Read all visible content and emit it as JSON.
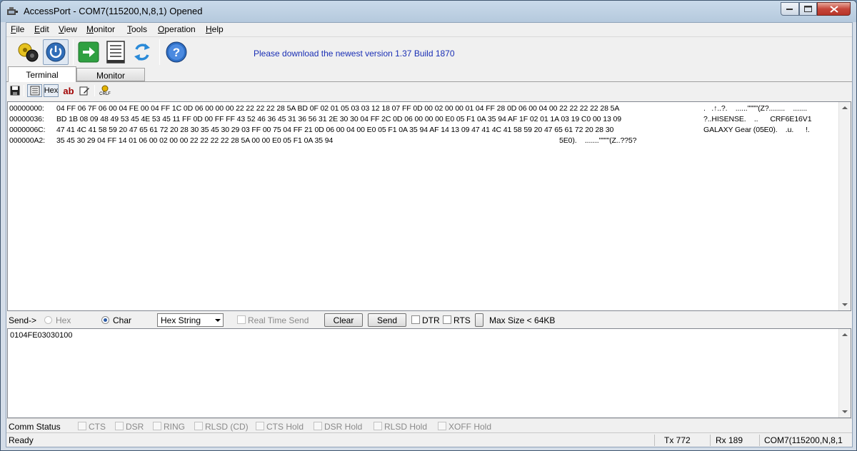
{
  "window": {
    "title": "AccessPort - COM7(115200,N,8,1) Opened"
  },
  "menu": [
    "File",
    "Edit",
    "View",
    "Monitor",
    "Tools",
    "Operation",
    "Help"
  ],
  "toolbar": {
    "promo": "Please download the newest version 1.37 Build 1870",
    "icons": [
      "settings-gear-icon",
      "power-icon",
      "arrow-right-icon",
      "document-icon",
      "refresh-icon",
      "help-icon"
    ]
  },
  "tabs": {
    "terminal": "Terminal",
    "monitor": "Monitor"
  },
  "subtoolbar": {
    "hex": "Hex",
    "ab": "ab",
    "crlf": "CRLF"
  },
  "terminal": {
    "lines": [
      {
        "addr": "00000000:",
        "hex": "04 FF 06 7F 06 00 04 FE 00 04 FF 1C 0D 06 00 00 00 22 22 22 22 28 5A BD 0F 02 01 05 03 03 12 18 07 FF 0D 00 02 00 00 01 04 FF 28 0D 06 00 04 00 22 22 22 22 28 5A",
        "ascii": ".   .↑..?.    ......\"\"\"\"(Z?........    ......."
      },
      {
        "addr": "00000036:",
        "hex": "BD 1B 08 09 48 49 53 45 4E 53 45 11 FF 0D 00 FF FF 43 52 46 36 45 31 36 56 31 2E 30 30 04 FF 2C 0D 06 00 00 00 E0 05 F1 0A 35 94 AF 1F 02 01 1A 03 19 C0 00 13 09",
        "ascii": "?..HISENSE.    ..      CRF6E16V1"
      },
      {
        "addr": "0000006C:",
        "hex": "47 41 4C 41 58 59 20 47 65 61 72 20 28 30 35 45 30 29 03 FF 00 75 04 FF 21 0D 06 00 04 00 E0 05 F1 0A 35 94 AF 14 13 09 47 41 4C 41 58 59 20 47 65 61 72 20 28 30",
        "ascii": "GALAXY Gear (05E0).    .u.      !."
      },
      {
        "addr": "000000A2:",
        "hex": "35 45 30 29 04 FF 14 01 06 00 02 00 00 22 22 22 22 28 5A 00 00 E0 05 F1 0A 35 94",
        "ascii": "5E0).    .......\"\"\"\"(Z..??5?"
      }
    ]
  },
  "sendbar": {
    "label": "Send->",
    "hex": "Hex",
    "char": "Char",
    "format": "Hex String",
    "realtime": "Real Time Send",
    "clear": "Clear",
    "send": "Send",
    "dtr": "DTR",
    "rts": "RTS",
    "maxsize": "Max Size < 64KB"
  },
  "sendarea": {
    "text": "0104FE03030100"
  },
  "comm": {
    "label": "Comm Status",
    "items": [
      "CTS",
      "DSR",
      "RING",
      "RLSD (CD)",
      "CTS Hold",
      "DSR Hold",
      "RLSD Hold",
      "XOFF Hold"
    ]
  },
  "status": {
    "ready": "Ready",
    "tx": "Tx 772",
    "rx": "Rx 189",
    "port": "COM7(115200,N,8,1"
  }
}
